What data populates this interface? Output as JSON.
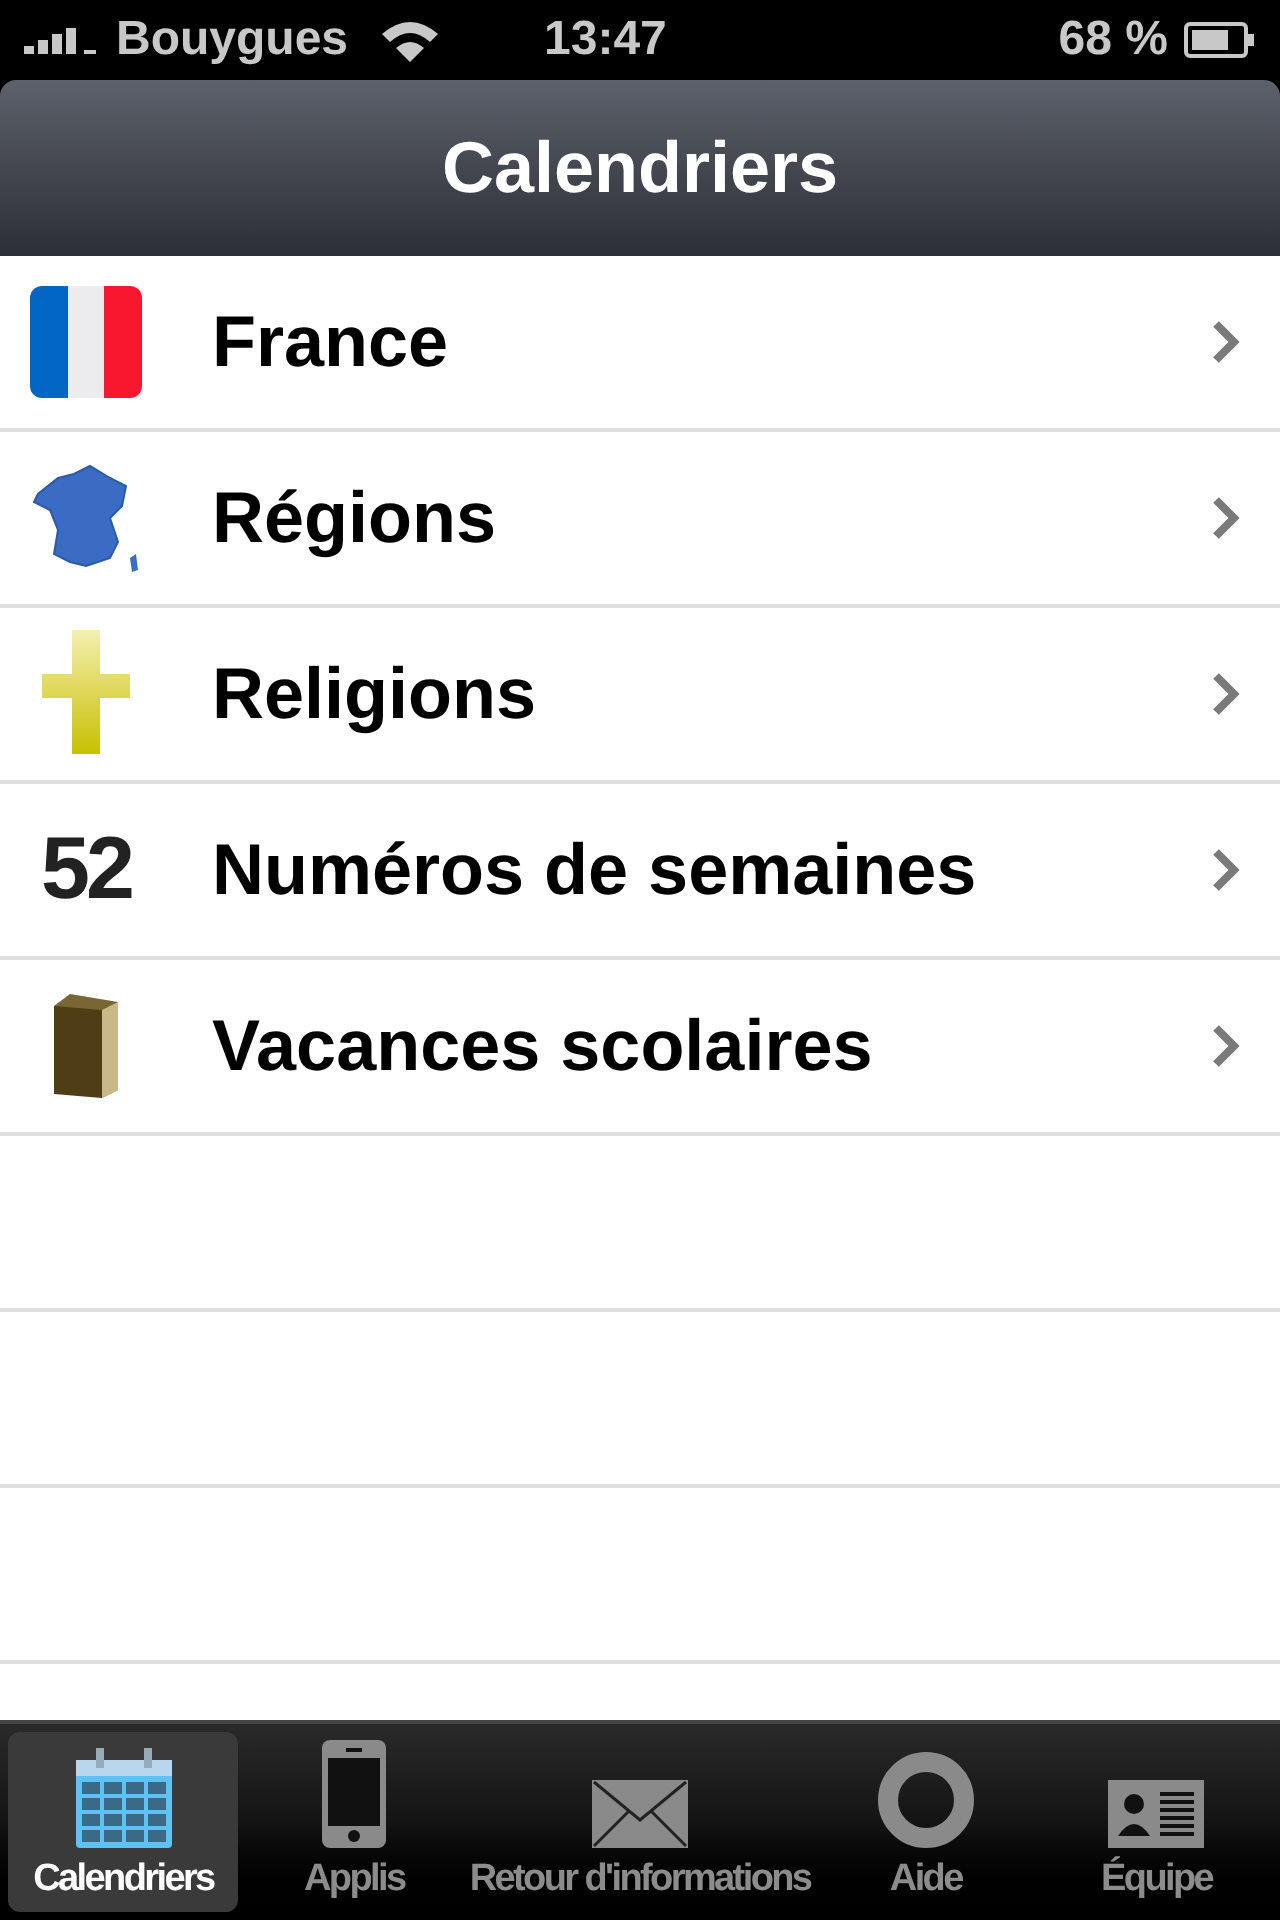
{
  "status_bar": {
    "carrier": "Bouygues",
    "time": "13:47",
    "battery": "68 %"
  },
  "nav_bar": {
    "title": "Calendriers"
  },
  "list": {
    "items": [
      {
        "kind": "flag",
        "label": "France"
      },
      {
        "kind": "map",
        "label": "Régions"
      },
      {
        "kind": "cross",
        "label": "Religions"
      },
      {
        "kind": "number",
        "badge": "52",
        "label": "Numéros de semaines"
      },
      {
        "kind": "book",
        "label": "Vacances scolaires"
      }
    ]
  },
  "tab_bar": {
    "tabs": [
      {
        "kind": "calendar",
        "label": "Calendriers",
        "selected": true
      },
      {
        "kind": "phone",
        "label": "Applis",
        "selected": false
      },
      {
        "kind": "mail",
        "label": "Retour d'informations",
        "selected": false
      },
      {
        "kind": "lifebuoy",
        "label": "Aide",
        "selected": false
      },
      {
        "kind": "card",
        "label": "Équipe",
        "selected": false
      }
    ]
  }
}
